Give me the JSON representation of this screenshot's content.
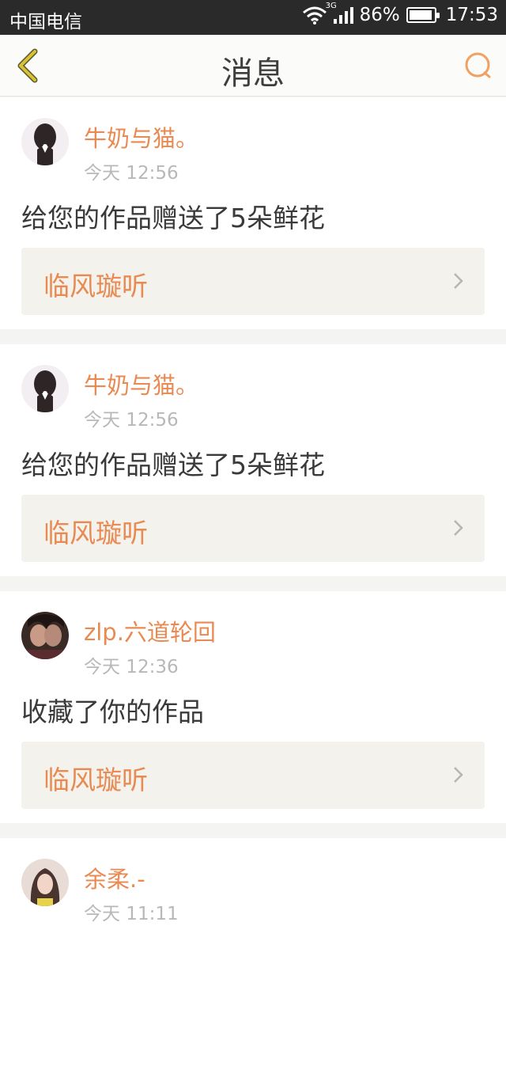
{
  "status": {
    "carrier": "中国电信",
    "network": "3G",
    "battery": "86%",
    "time": "17:53"
  },
  "nav": {
    "title": "消息"
  },
  "messages": [
    {
      "user": "牛奶与猫。",
      "time": "今天 12:56",
      "text": "给您的作品赠送了5朵鲜花",
      "work": "临风璇听"
    },
    {
      "user": "牛奶与猫。",
      "time": "今天 12:56",
      "text": "给您的作品赠送了5朵鲜花",
      "work": "临风璇听"
    },
    {
      "user": "zlp.六道轮回",
      "time": "今天 12:36",
      "text": "收藏了你的作品",
      "work": "临风璇听"
    },
    {
      "user": "余柔.-",
      "time": "今天 11:11",
      "text": "",
      "work": ""
    }
  ],
  "colors": {
    "accent": "#e88a52",
    "back_icon": "#d9c23a"
  }
}
